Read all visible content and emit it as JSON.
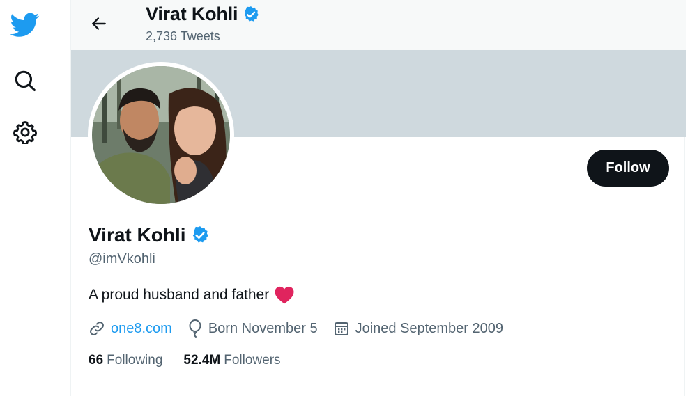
{
  "header": {
    "name": "Virat Kohli",
    "tweet_count": "2,736 Tweets"
  },
  "profile": {
    "name": "Virat Kohli",
    "handle": "@imVkohli",
    "bio": "A proud husband and father",
    "bio_emoji": "red-heart",
    "website": "one8.com",
    "birthday": "Born November 5",
    "joined": "Joined September 2009",
    "follow_label": "Follow",
    "verified": true
  },
  "stats": {
    "following_count": "66",
    "following_label": "Following",
    "followers_count": "52.4M",
    "followers_label": "Followers"
  },
  "icons": {
    "nav": [
      "twitter-bird-icon",
      "search-icon",
      "gear-icon"
    ],
    "meta": [
      "link-icon",
      "balloon-icon",
      "calendar-icon"
    ]
  },
  "colors": {
    "brand": "#1d9bf0",
    "banner": "#cfd9de",
    "follow_button": "#0f1419",
    "heart": "#e0245e"
  }
}
